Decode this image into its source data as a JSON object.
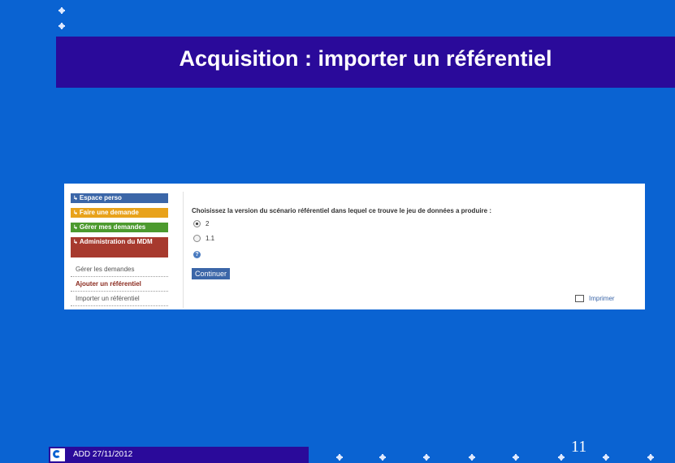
{
  "slide": {
    "title": "Acquisition : importer un référentiel",
    "footer": "ADD 27/11/2012",
    "page_number": "11"
  },
  "sidebar": {
    "items": [
      {
        "label": "Espace perso",
        "color": "#3b66a8"
      },
      {
        "label": "Faire une demande",
        "color": "#e8a21b"
      },
      {
        "label": "Gérer mes demandes",
        "color": "#4c9a2e"
      },
      {
        "label": "Administration du MDM",
        "color": "#a73a2e"
      }
    ],
    "sub_links": [
      {
        "label": "Gérer les demandes"
      },
      {
        "label": "Ajouter un référentiel"
      },
      {
        "label": "Importer un référentiel"
      }
    ]
  },
  "content": {
    "question": "Choisissez la version du scénario référentiel dans lequel ce trouve le jeu de données a produire  :",
    "options": [
      {
        "label": "2",
        "checked": true
      },
      {
        "label": "1.1",
        "checked": false
      }
    ],
    "continue_label": "Continuer",
    "print_label": "Imprimer"
  }
}
